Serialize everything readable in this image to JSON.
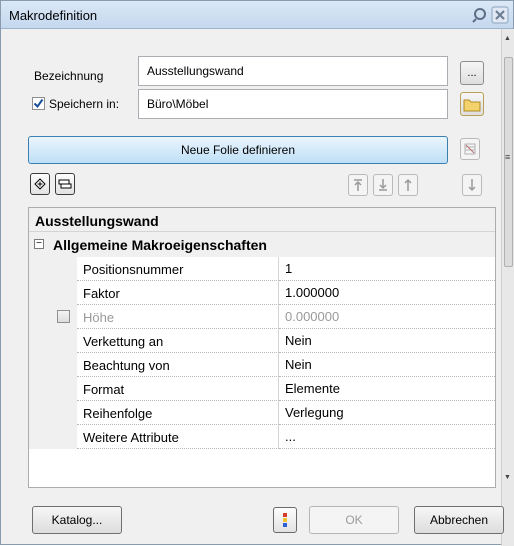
{
  "window": {
    "title": "Makrodefinition"
  },
  "fields": {
    "bezeichnung_label": "Bezeichnung",
    "bezeichnung_value": "Ausstellungswand",
    "browse_label": "...",
    "speichern_label": "Speichern in:",
    "speichern_value": "Büro\\Möbel",
    "speichern_checked": true
  },
  "buttons": {
    "neue_folie": "Neue Folie definieren",
    "katalog": "Katalog...",
    "ok": "OK",
    "abbrechen": "Abbrechen"
  },
  "grid": {
    "header": "Ausstellungswand",
    "section": "Allgemeine Makroeigenschaften",
    "rows": [
      {
        "name": "Positionsnummer",
        "value": "1"
      },
      {
        "name": "Faktor",
        "value": "1.000000"
      },
      {
        "name": "Höhe",
        "value": "0.000000"
      },
      {
        "name": "Verkettung an",
        "value": "Nein"
      },
      {
        "name": "Beachtung von",
        "value": "Nein"
      },
      {
        "name": "Format",
        "value": "Elemente"
      },
      {
        "name": "Reihenfolge",
        "value": "Verlegung"
      },
      {
        "name": "Weitere Attribute",
        "value": "..."
      }
    ]
  },
  "colors": {
    "accent": "#3c7fb1",
    "titlebar": "#c4d8ef",
    "checkmark": "#1b4f9c"
  }
}
